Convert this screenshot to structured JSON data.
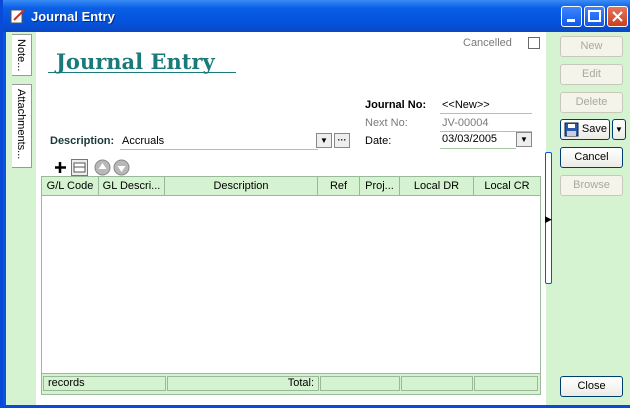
{
  "window": {
    "title": "Journal Entry"
  },
  "side_tabs": {
    "note": "Note...",
    "attachments": "Attachments..."
  },
  "header": {
    "heading": "Journal Entry",
    "cancelled_label": "Cancelled",
    "cancelled_checked": false
  },
  "form": {
    "journal_no_label": "Journal No:",
    "journal_no_value": "<<New>>",
    "next_no_label": "Next No:",
    "next_no_value": "JV-00004",
    "date_label": "Date:",
    "date_value": "03/03/2005",
    "description_label": "Description:",
    "description_value": "Accruals",
    "ellipsis": "···"
  },
  "grid": {
    "columns": [
      "G/L Code",
      "GL Descri...",
      "Description",
      "Ref",
      "Proj...",
      "Local DR",
      "Local CR"
    ],
    "rows": [],
    "footer_records": "records",
    "footer_total": "Total:"
  },
  "buttons": {
    "new": "New",
    "edit": "Edit",
    "delete": "Delete",
    "save": "Save",
    "cancel": "Cancel",
    "browse": "Browse",
    "close": "Close"
  },
  "colors": {
    "accent": "#1a7a7a",
    "panel": "#d6f3d1",
    "titlebar": "#0a55dd"
  }
}
